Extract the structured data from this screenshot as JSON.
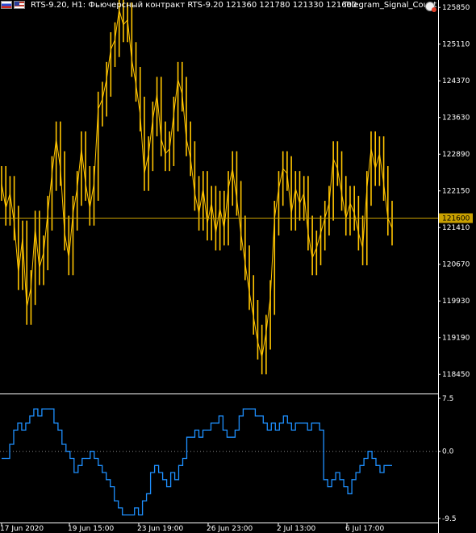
{
  "header": {
    "text": "RTS-9.20, H1:  Фьючерсный контракт RTS-9.20  121360 121780 121330 121600",
    "indicator_name": "Telegram_Signal_Count"
  },
  "colors": {
    "candle": "#ffc400",
    "price_line": "#c9a000",
    "price_tag_bg": "#c9a000",
    "oscillator": "#1e90ff",
    "background": "#000000",
    "grid": "#ffffff"
  },
  "chart_data": [
    {
      "type": "line",
      "panel": "price",
      "price_axis_labels": [
        "125850",
        "125110",
        "124370",
        "123630",
        "122890",
        "122150",
        "121410",
        "120670",
        "119930",
        "119190",
        "118450"
      ],
      "ylim": [
        118080,
        126000
      ],
      "current_price": 121600,
      "x_labels": [
        "17 Jun 2020",
        "19 Jun 15:00",
        "23 Jun 19:00",
        "26 Jun 23:00",
        "2 Jul 13:00",
        "6 Jul 17:00"
      ],
      "series": [
        {
          "values": [
            122300,
            121800,
            122100,
            121500,
            120500,
            121200,
            119800,
            120200,
            121400,
            120600,
            120900,
            121700,
            122500,
            123200,
            122600,
            121300,
            120800,
            121700,
            122200,
            123000,
            122300,
            121800,
            122300,
            123800,
            124000,
            124400,
            125000,
            125200,
            125800,
            125500,
            125600,
            124800,
            124300,
            123700,
            122500,
            122900,
            123600,
            124100,
            123200,
            122900,
            123000,
            123700,
            124400,
            124100,
            123200,
            122800,
            122100,
            121700,
            122200,
            121500,
            121900,
            121300,
            121800,
            121400,
            122200,
            122600,
            122000,
            121300,
            120700,
            120100,
            119600,
            119100,
            118800,
            119300,
            120000,
            121600,
            122200,
            122600,
            122500,
            121700,
            122200,
            121900,
            122100,
            121300,
            120800,
            121000,
            121300,
            121600,
            121900,
            122800,
            122600,
            122100,
            121600,
            121900,
            121700,
            121300,
            121000,
            122200,
            123000,
            122600,
            122900,
            122300,
            121600,
            121400
          ]
        }
      ]
    },
    {
      "type": "line",
      "panel": "indicator",
      "name": "Telegram_Signal_Count",
      "axis_labels": [
        "7.5",
        "0.0",
        "-9.5"
      ],
      "ylim": [
        -9.5,
        7.5
      ],
      "reference_line": 0.0,
      "series": [
        {
          "values": [
            -1,
            -1,
            1,
            3,
            4,
            3,
            4,
            5,
            6,
            5,
            6,
            6,
            6,
            4,
            3,
            1,
            0,
            -1,
            -3,
            -2,
            -1,
            -1,
            0,
            -1,
            -2,
            -3,
            -4,
            -5,
            -7,
            -8,
            -9,
            -9,
            -9,
            -8,
            -9,
            -7,
            -6,
            -3,
            -2,
            -3,
            -4,
            -5,
            -3,
            -4,
            -2,
            -1,
            2,
            2,
            3,
            2,
            3,
            3,
            4,
            4,
            5,
            3,
            2,
            2,
            3,
            5,
            6,
            6,
            6,
            5,
            5,
            4,
            3,
            4,
            3,
            4,
            5,
            4,
            3,
            4,
            4,
            4,
            3,
            4,
            4,
            3,
            -4,
            -5,
            -4,
            -3,
            -4,
            -5,
            -6,
            -4,
            -3,
            -2,
            -1,
            0,
            -1,
            -2,
            -3,
            -2,
            -2,
            -2
          ]
        }
      ]
    }
  ]
}
